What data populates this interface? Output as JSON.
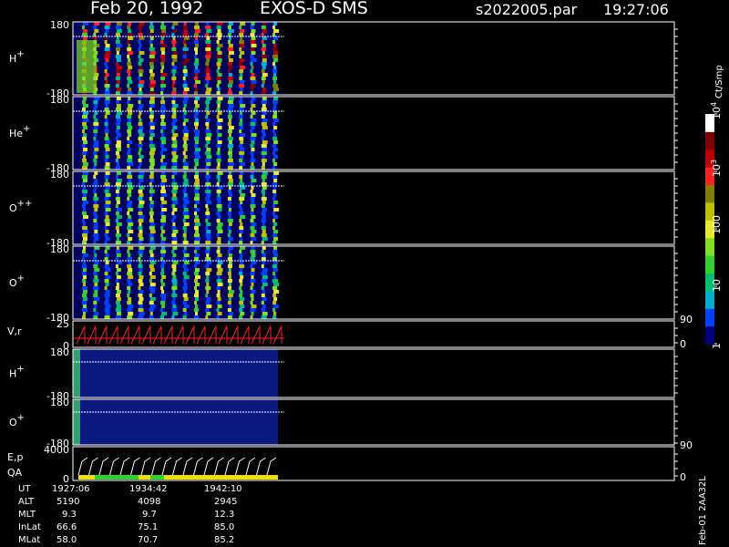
{
  "header": {
    "date": "Feb 20, 1992",
    "instrument": "EXOS-D SMS",
    "file": "s2022005.par",
    "time": "19:27:06"
  },
  "colorbar": {
    "unit": "Ct/Smp",
    "ticks": [
      {
        "label": "1",
        "value": 1
      },
      {
        "label": "10",
        "value": 10
      },
      {
        "label": "100",
        "value": 100
      },
      {
        "label": "10",
        "sup": "3",
        "value": 1000
      },
      {
        "label": "10",
        "sup": "4",
        "value": 10000
      }
    ],
    "colors": [
      "#000080",
      "#0040ff",
      "#00b0d0",
      "#00c070",
      "#30d030",
      "#80e020",
      "#e8e830",
      "#c0c000",
      "#808000",
      "#ff2020",
      "#c00000",
      "#800000",
      "#ffffff"
    ]
  },
  "footer": {
    "side_label": "Feb-01 2AA32L",
    "rows": [
      {
        "name": "UT",
        "values": [
          "1927:06",
          "1934:42",
          "1942:10"
        ]
      },
      {
        "name": "ALT",
        "values": [
          "5190",
          "4098",
          "2945"
        ]
      },
      {
        "name": "MLT",
        "values": [
          "9.3",
          "9.7",
          "12.3"
        ]
      },
      {
        "name": "InLat",
        "values": [
          "66.6",
          "75.1",
          "85.0"
        ]
      },
      {
        "name": "MLat",
        "values": [
          "58.0",
          "70.7",
          "85.2"
        ]
      }
    ]
  },
  "chart_data": {
    "type": "heatmap",
    "panels": [
      {
        "species": "H",
        "charge": "+",
        "ylim": [
          -180,
          180
        ],
        "ytick_labels": [
          "180",
          "-180"
        ]
      },
      {
        "species": "He",
        "charge": "+",
        "ylim": [
          -180,
          180
        ],
        "ytick_labels": [
          "180",
          "-180"
        ]
      },
      {
        "species": "O",
        "charge": "++",
        "ylim": [
          -180,
          180
        ],
        "ytick_labels": [
          "180",
          "-180"
        ]
      },
      {
        "species": "O",
        "charge": "+",
        "ylim": [
          -180,
          180
        ],
        "ytick_labels": [
          "180",
          "-180"
        ]
      },
      {
        "label": "V,r",
        "left_ylim": [
          0,
          25
        ],
        "left_ticks": [
          "25",
          "0"
        ],
        "right_ylim": [
          0,
          90
        ],
        "right_ticks": [
          "90",
          "0"
        ]
      },
      {
        "species": "H",
        "charge": "+",
        "ylim": [
          -180,
          180
        ],
        "ytick_labels": [
          "180",
          "-180"
        ]
      },
      {
        "species": "O",
        "charge": "+",
        "ylim": [
          -180,
          180
        ],
        "ytick_labels": [
          "180",
          "-180"
        ]
      },
      {
        "label": "E,p",
        "label2": "QA",
        "left_ylim": [
          0,
          4000
        ],
        "left_ticks": [
          "4000",
          "0"
        ],
        "right_ylim": [
          0,
          90
        ],
        "right_ticks": [
          "90",
          "0"
        ]
      }
    ]
  }
}
